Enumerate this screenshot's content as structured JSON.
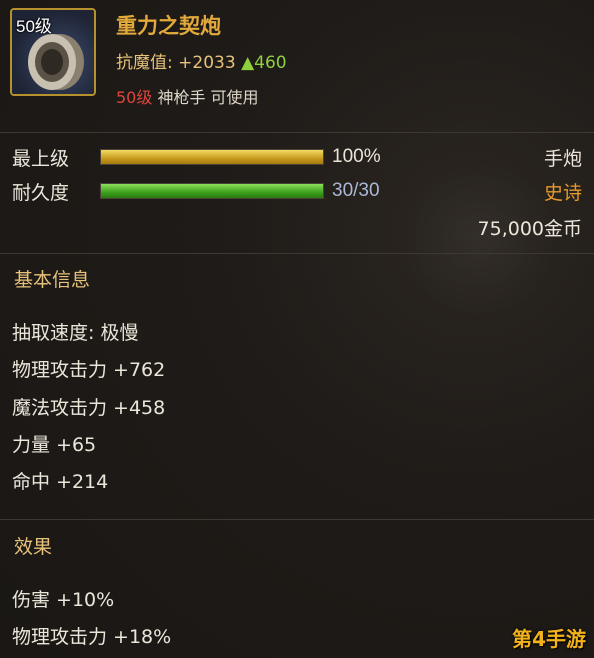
{
  "item": {
    "level_badge": "50级",
    "name": "重力之契炮",
    "stat_label": "抗魔值:",
    "stat_value": "+2033",
    "stat_delta": "▲460",
    "required_level": "50级",
    "required_class": "神枪手 可使用"
  },
  "bars": {
    "grade": {
      "label": "最上级",
      "value_text": "100%",
      "fill": 1.0
    },
    "durability": {
      "label": "耐久度",
      "value_text": "30/30",
      "fill": 1.0
    }
  },
  "right": {
    "type": "手炮",
    "rarity": "史诗",
    "price": "75,000金币"
  },
  "basic_info": {
    "title": "基本信息",
    "rows": [
      "抽取速度: 极慢",
      "物理攻击力 +762",
      "魔法攻击力 +458",
      "力量 +65",
      "命中 +214"
    ]
  },
  "effects": {
    "title": "效果",
    "rows": [
      "伤害 +10%",
      "物理攻击力 +18%"
    ]
  },
  "watermark": "第4手游",
  "colors": {
    "name": "#e3a93a",
    "rarity": "#e59a2c",
    "level_requirement": "#e0453b",
    "stat_delta": "#8fd13d"
  }
}
